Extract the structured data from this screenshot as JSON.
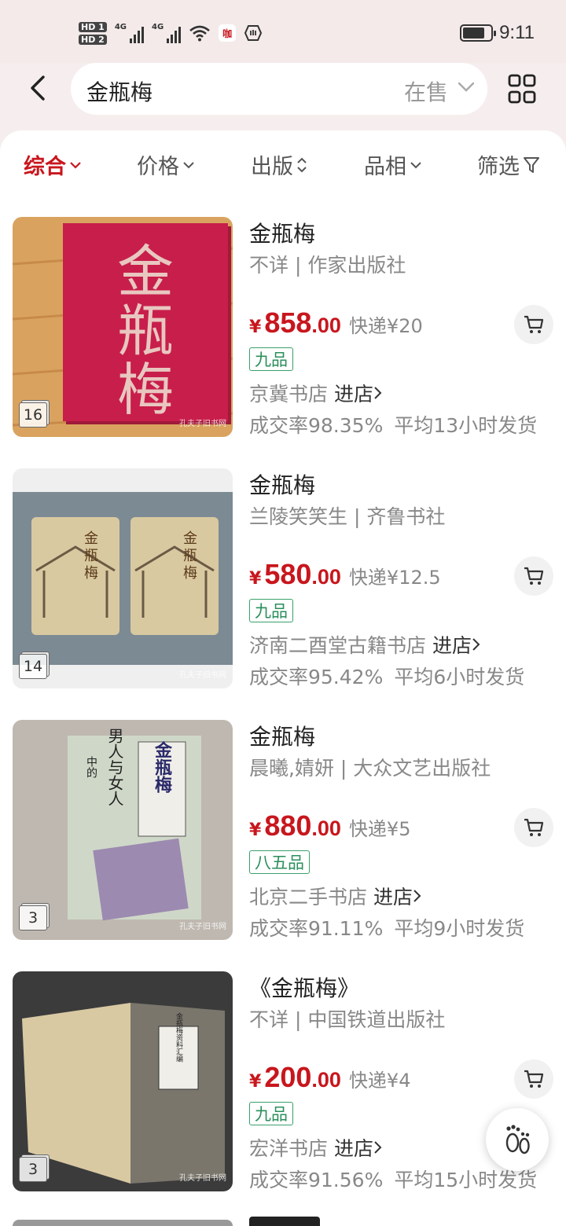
{
  "status_bar": {
    "hd1": "HD 1",
    "hd2": "HD 2",
    "net1": "4G",
    "net2": "4G",
    "app_badge": "咖",
    "time": "9:11",
    "battery_level": 0.8
  },
  "search": {
    "query": "金瓶梅",
    "status_filter": "在售"
  },
  "sort_tabs": [
    {
      "label": "综合",
      "active": true
    },
    {
      "label": "价格",
      "active": false
    },
    {
      "label": "出版",
      "active": false
    },
    {
      "label": "品相",
      "active": false
    },
    {
      "label": "筛选",
      "active": false
    }
  ],
  "products": [
    {
      "title": "金瓶梅",
      "author_publisher": "不详 | 作家出版社",
      "price_currency": "¥",
      "price_int": "858",
      "price_dec": ".00",
      "shipping": "快递¥20",
      "condition": "九品",
      "store": "京冀书店",
      "enter_label": "进店",
      "deal_rate": "成交率98.35%",
      "ship_time": "平均13小时发货",
      "image_count": "16",
      "watermark": "孔夫子旧书网"
    },
    {
      "title": "金瓶梅",
      "author_publisher": "兰陵笑笑生 | 齐鲁书社",
      "price_currency": "¥",
      "price_int": "580",
      "price_dec": ".00",
      "shipping": "快递¥12.5",
      "condition": "九品",
      "store": "济南二酉堂古籍书店",
      "enter_label": "进店",
      "deal_rate": "成交率95.42%",
      "ship_time": "平均6小时发货",
      "image_count": "14",
      "watermark": "孔夫子旧书网"
    },
    {
      "title": "金瓶梅",
      "author_publisher": "晨曦,婧妍 | 大众文艺出版社",
      "price_currency": "¥",
      "price_int": "880",
      "price_dec": ".00",
      "shipping": "快递¥5",
      "condition": "八五品",
      "store": "北京二手书店",
      "enter_label": "进店",
      "deal_rate": "成交率91.11%",
      "ship_time": "平均9小时发货",
      "image_count": "3",
      "watermark": "孔夫子旧书网"
    },
    {
      "title": "《金瓶梅》",
      "author_publisher": "不详 | 中国铁道出版社",
      "price_currency": "¥",
      "price_int": "200",
      "price_dec": ".00",
      "shipping": "快递¥4",
      "condition": "九品",
      "store": "宏洋书店",
      "enter_label": "进店",
      "deal_rate": "成交率91.56%",
      "ship_time": "平均15小时发货",
      "image_count": "3",
      "watermark": "孔夫子旧书网"
    }
  ],
  "cover_texts": {
    "p1": [
      "金",
      "瓶",
      "梅"
    ],
    "p2": [
      "金",
      "瓶",
      "梅"
    ],
    "p3_main": "金瓶梅",
    "p3_sub": "男人与女人",
    "p3_small": "中的",
    "p4": "金瓶梅资料汇编"
  },
  "icons": {
    "back": "back-arrow-icon",
    "grid": "grid-icon",
    "cart": "cart-icon",
    "footprint": "footprint-icon",
    "filter": "filter-icon"
  },
  "colors": {
    "accent": "#c8161d",
    "condition_green": "#2a8f5b"
  }
}
